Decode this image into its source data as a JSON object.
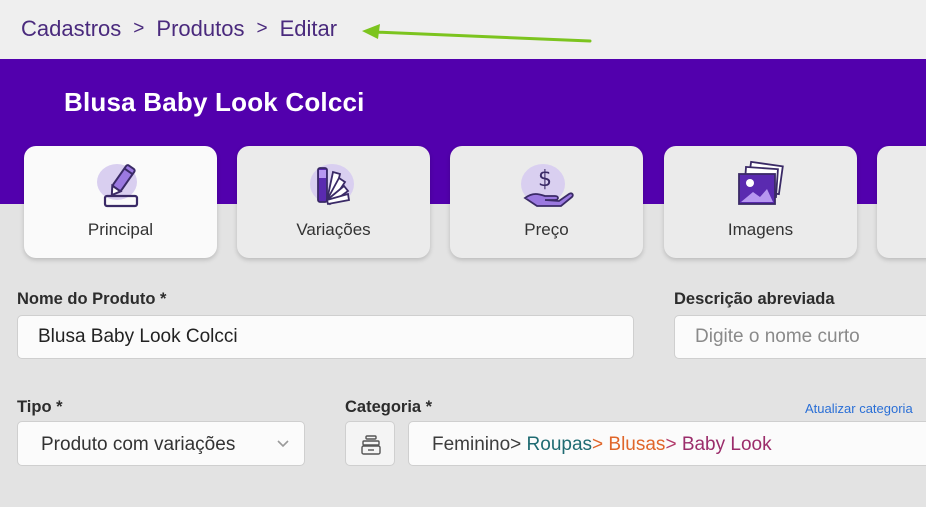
{
  "breadcrumb": {
    "items": [
      "Cadastros",
      "Produtos",
      "Editar"
    ],
    "separator": ">"
  },
  "header": {
    "product_title": "Blusa Baby Look Colcci",
    "band_color": "#5200ad"
  },
  "tabs": [
    {
      "label": "Principal",
      "icon": "pencil-icon",
      "active": true
    },
    {
      "label": "Variações",
      "icon": "swatches-icon",
      "active": false
    },
    {
      "label": "Preço",
      "icon": "price-hand-icon",
      "active": false
    },
    {
      "label": "Imagens",
      "icon": "images-icon",
      "active": false
    }
  ],
  "form": {
    "product_name": {
      "label": "Nome do Produto *",
      "value": "Blusa Baby Look Colcci"
    },
    "short_description": {
      "label": "Descrição abreviada",
      "placeholder": "Digite o nome curto"
    },
    "type": {
      "label": "Tipo *",
      "value": "Produto com variações"
    },
    "category": {
      "label": "Categoria *",
      "update_link": "Atualizar categoria",
      "path": [
        {
          "text": "Feminino",
          "color": "#3d3d3d"
        },
        {
          "text": "> ",
          "color": "#3d3d3d"
        },
        {
          "text": "Roupas",
          "color": "#1f6b72"
        },
        {
          "text": "> ",
          "color": "#e0662a"
        },
        {
          "text": "Blusas",
          "color": "#e0662a"
        },
        {
          "text": "> ",
          "color": "#b23a6a"
        },
        {
          "text": "Baby Look",
          "color": "#9b2d6b"
        }
      ]
    }
  },
  "colors": {
    "accent": "#5200ad",
    "annotation_arrow": "#7cc41f",
    "link": "#2a6fd6"
  }
}
